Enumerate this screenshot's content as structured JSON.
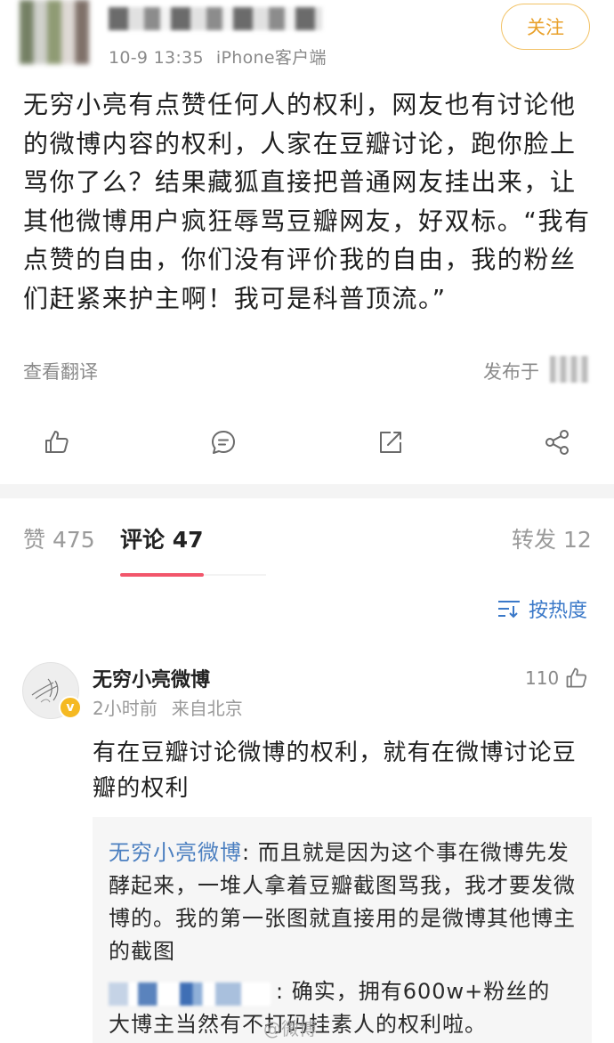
{
  "post": {
    "time": "10-9 13:35",
    "source": "iPhone客户端",
    "follow_label": "关注",
    "text": "无穷小亮有点赞任何人的权利，网友也有讨论他的微博内容的权利，人家在豆瓣讨论，跑你脸上骂你了么？结果藏狐直接把普通网友挂出来，让其他微博用户疯狂辱骂豆瓣网友，好双标。“我有点赞的自由，你们没有评价我的自由，我的粉丝们赶紧来护主啊！我可是科普顶流。”",
    "translate_label": "查看翻译",
    "published_label": "发布于"
  },
  "tabs": [
    {
      "label": "赞 475"
    },
    {
      "label": "评论 47"
    },
    {
      "label": "转发 12"
    }
  ],
  "sort_label": "按热度",
  "comment": {
    "author": "无穷小亮微博",
    "time": "2小时前",
    "location": "来自北京",
    "likes": "110",
    "text": "有在豆瓣讨论微博的权利，就有在微博讨论豆瓣的权利",
    "reply1_author": "无穷小亮微博",
    "reply1_text": ": 而且就是因为这个事在微博先发酵起来，一堆人拿着豆瓣截图骂我，我才要发微博的。我的第一张图就直接用的是微博其他博主的截图",
    "reply2_text_a": ": 确实，拥有600w+粉丝的",
    "reply2_text_b": "大博主当然有不打码挂素人的权利啦。"
  },
  "watermark": "@微博"
}
